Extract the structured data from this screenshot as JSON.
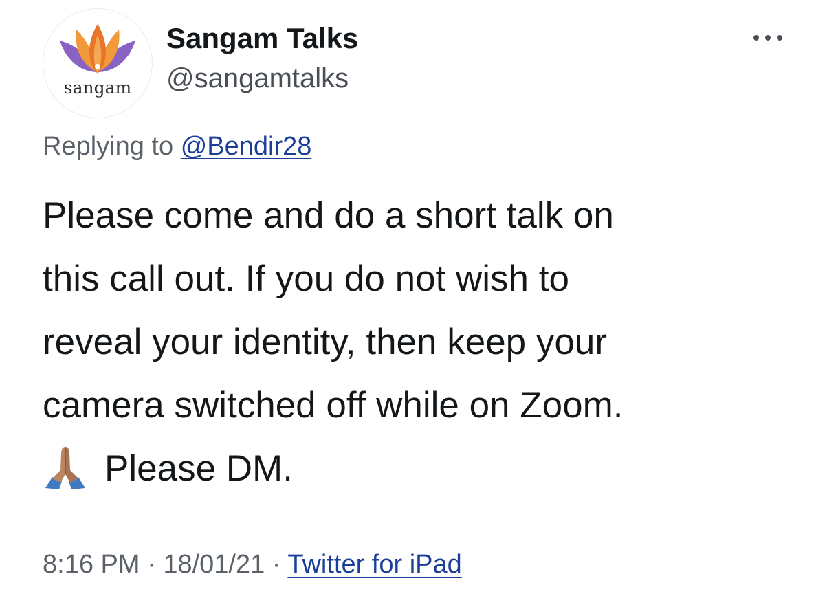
{
  "author": {
    "display_name": "Sangam Talks",
    "handle": "@sangamtalks",
    "avatar_text": "sangam",
    "avatar_icon": "lotus-logo"
  },
  "more_icon": "more-options-icon",
  "reply": {
    "prefix": "Replying to",
    "mention": "@Bendir28"
  },
  "tweet": {
    "lines": [
      "Please come and do a short talk on",
      "this call out. If you do not wish to",
      "reveal your identity, then keep your",
      "camera switched off while on Zoom."
    ],
    "last_line": "Please DM.",
    "emoji_icon": "folded-hands-emoji"
  },
  "meta": {
    "time": "8:16 PM",
    "separator": "·",
    "date": "18/01/21",
    "source": "Twitter for iPad"
  },
  "colors": {
    "link": "#1b3f99",
    "text": "#14171a",
    "secondary": "#5b6168",
    "lotus_purple": "#8a62c4",
    "lotus_orange": "#ef8a2c"
  }
}
